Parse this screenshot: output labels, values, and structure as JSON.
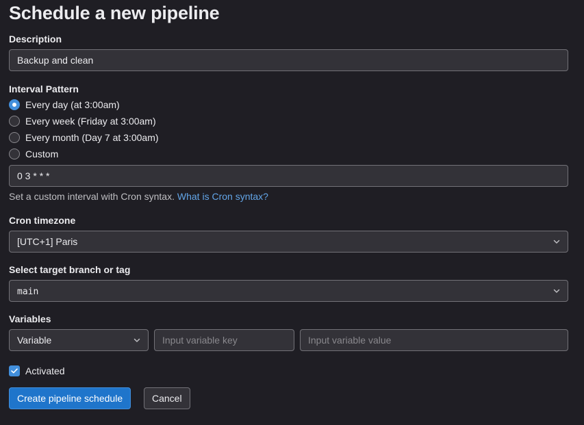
{
  "page": {
    "title": "Schedule a new pipeline"
  },
  "description": {
    "label": "Description",
    "value": "Backup and clean"
  },
  "interval": {
    "label": "Interval Pattern",
    "options": [
      {
        "label": "Every day (at 3:00am)",
        "checked": true
      },
      {
        "label": "Every week (Friday at 3:00am)",
        "checked": false
      },
      {
        "label": "Every month (Day 7 at 3:00am)",
        "checked": false
      },
      {
        "label": "Custom",
        "checked": false
      }
    ],
    "cron_value": "0 3 * * *",
    "help_text": "Set a custom interval with Cron syntax.",
    "help_link": "What is Cron syntax?"
  },
  "timezone": {
    "label": "Cron timezone",
    "selected": "[UTC+1] Paris"
  },
  "branch": {
    "label": "Select target branch or tag",
    "selected": "main"
  },
  "variables": {
    "label": "Variables",
    "type_selected": "Variable",
    "key_placeholder": "Input variable key",
    "value_placeholder": "Input variable value"
  },
  "activated": {
    "label": "Activated",
    "checked": true
  },
  "actions": {
    "create_label": "Create pipeline schedule",
    "cancel_label": "Cancel"
  },
  "colors": {
    "background": "#1f1e24",
    "accent": "#428fdc",
    "link": "#63a6e9"
  }
}
